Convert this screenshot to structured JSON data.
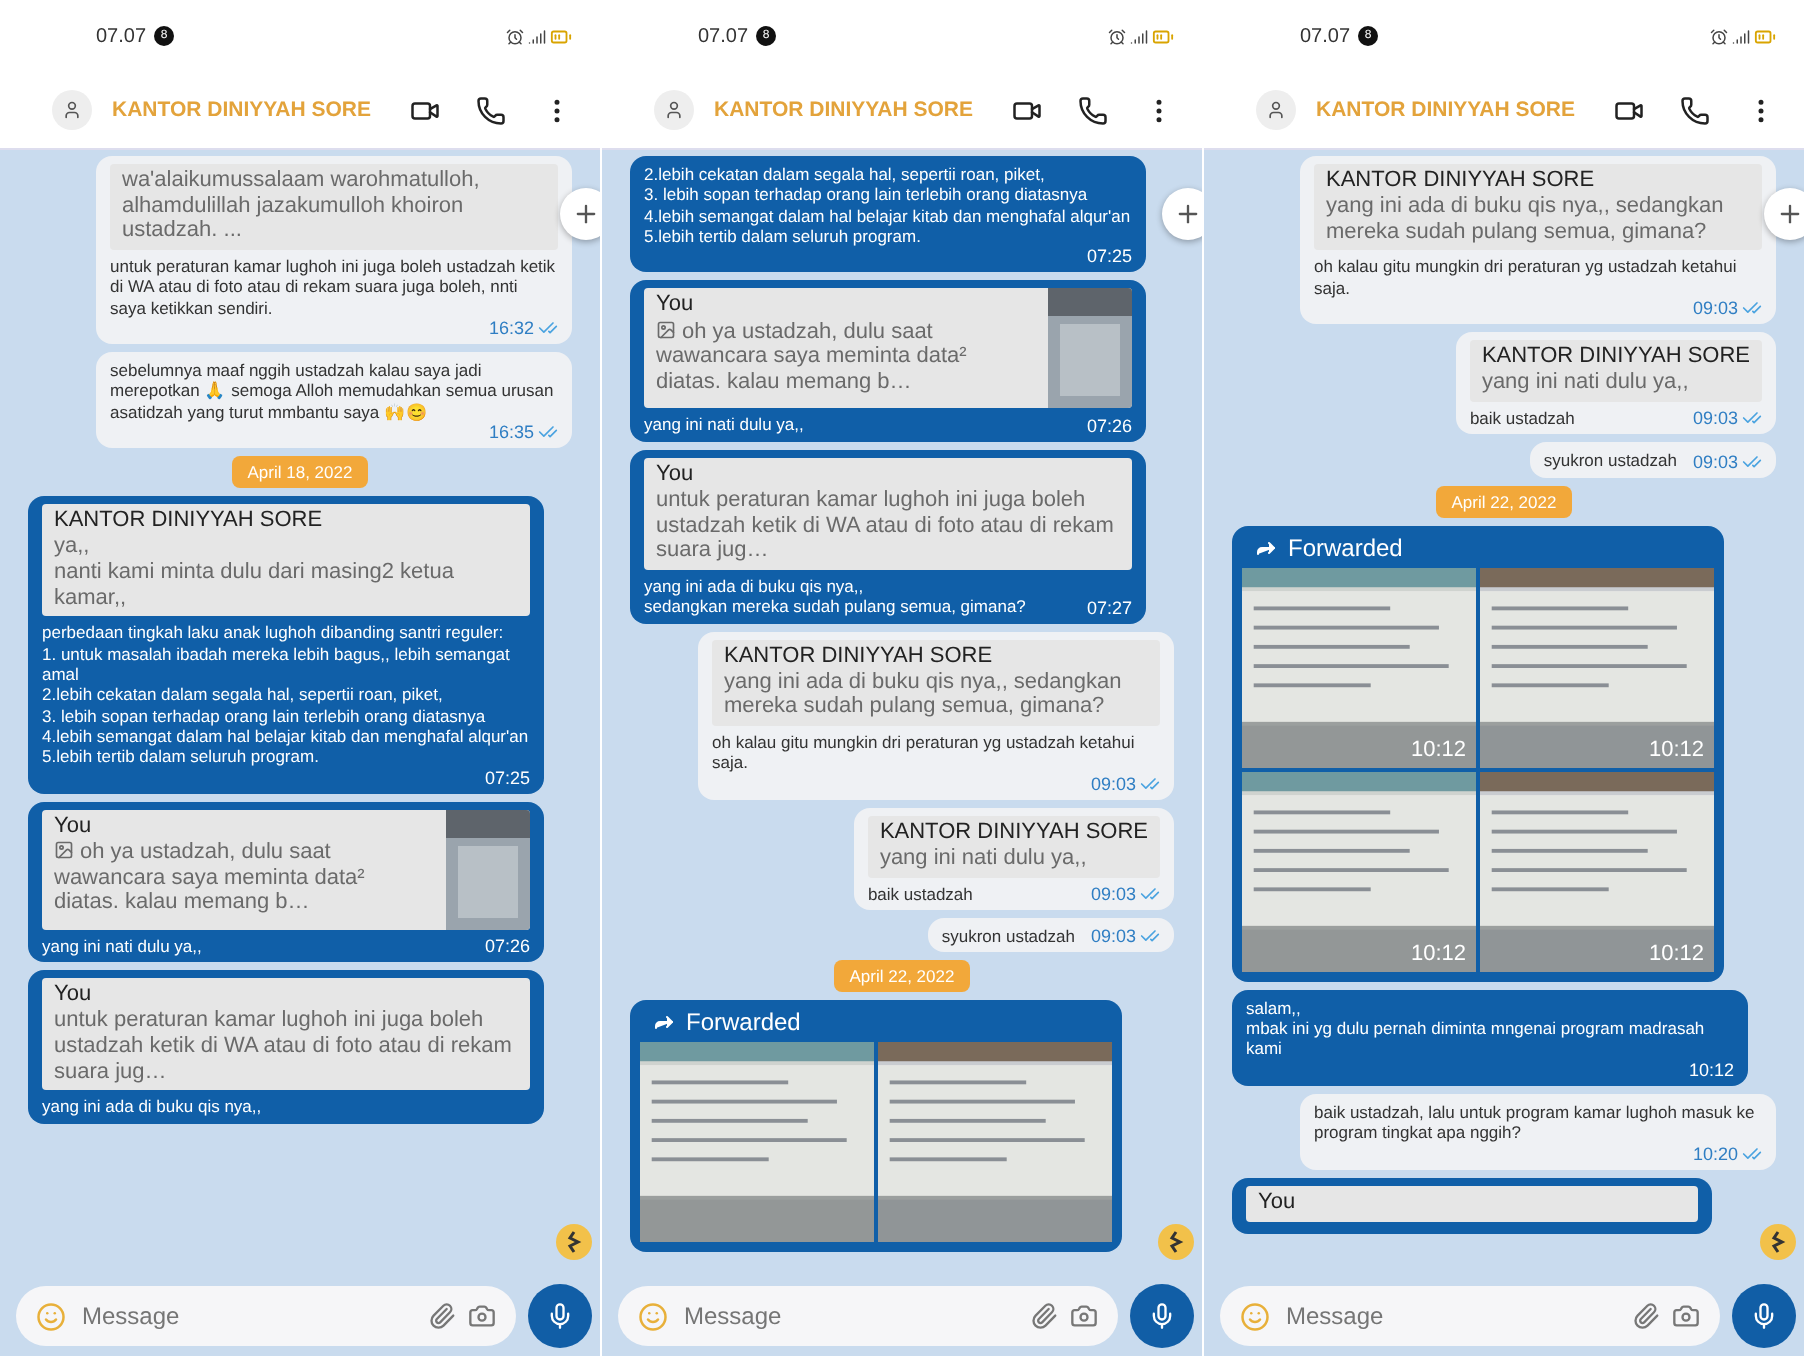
{
  "phones": [
    {
      "status": {
        "time": "07.07",
        "notification_count": "8"
      },
      "chat_title": "KANTOR DINIYYAH SORE",
      "composer": {
        "placeholder": "Message"
      },
      "messages": [
        {
          "kind": "message",
          "outgoing": true,
          "quote": {
            "text": "wa'alaikumussalaam warohmatulloh, alhamdulillah jazakumulloh khoiron ustadzah. ..."
          },
          "text": "untuk peraturan kamar lughoh ini juga boleh ustadzah ketik di WA atau di foto atau di rekam suara juga boleh, nnti saya ketikkan sendiri.",
          "time": "16:32",
          "read": true
        },
        {
          "kind": "message",
          "outgoing": true,
          "text": "sebelumnya maaf nggih ustadzah kalau saya  jadi merepotkan 🙏 semoga Alloh memudahkan semua urusan  asatidzah yang turut mmbantu saya 🙌😊",
          "time": "16:35",
          "read": true
        },
        {
          "kind": "date",
          "text": "April 18, 2022"
        },
        {
          "kind": "message",
          "outgoing": false,
          "quote": {
            "author": "KANTOR DINIYYAH SORE",
            "text": "ya,,\nnanti kami minta dulu dari masing2 ketua kamar,,"
          },
          "text": "perbedaan tingkah laku anak lughoh dibanding santri reguler:\n1. untuk masalah ibadah mereka lebih bagus,, lebih semangat amal\n2.lebih cekatan dalam segala hal, sepertii roan, piket,\n3. lebih sopan terhadap orang lain terlebih orang diatasnya\n4.lebih semangat dalam hal belajar kitab dan menghafal alqur'an\n5.lebih tertib dalam seluruh program.",
          "time": "07:25"
        },
        {
          "kind": "message",
          "outgoing": false,
          "quote": {
            "author": "You",
            "text": "oh ya ustadzah, dulu saat wawancara saya meminta data² diatas. kalau memang b…",
            "image": true
          },
          "text": "yang ini nati dulu ya,,",
          "time": "07:26"
        },
        {
          "kind": "message",
          "outgoing": false,
          "quote": {
            "author": "You",
            "text": "untuk peraturan kamar lughoh ini juga boleh ustadzah ketik di WA atau di foto atau di rekam suara jug…"
          },
          "text": "yang ini ada di buku qis nya,,"
        }
      ]
    },
    {
      "status": {
        "time": "07.07",
        "notification_count": "8"
      },
      "chat_title": "KANTOR DINIYYAH SORE",
      "composer": {
        "placeholder": "Message"
      },
      "messages": [
        {
          "kind": "message",
          "outgoing": false,
          "text": "2.lebih cekatan dalam segala hal, sepertii roan, piket,\n3. lebih sopan terhadap orang lain terlebih orang diatasnya\n4.lebih semangat dalam hal belajar kitab dan menghafal alqur'an\n5.lebih tertib dalam seluruh program.",
          "time": "07:25"
        },
        {
          "kind": "message",
          "outgoing": false,
          "quote": {
            "author": "You",
            "text": "oh ya ustadzah, dulu saat wawancara saya meminta data² diatas. kalau memang b…",
            "image": true
          },
          "text": "yang ini nati dulu ya,,",
          "time": "07:26"
        },
        {
          "kind": "message",
          "outgoing": false,
          "quote": {
            "author": "You",
            "text": "untuk peraturan kamar lughoh ini juga boleh ustadzah ketik di WA atau di foto atau di rekam suara jug…"
          },
          "text": "yang ini ada di buku qis nya,,\nsedangkan mereka sudah pulang semua, gimana?",
          "time": "07:27"
        },
        {
          "kind": "message",
          "outgoing": true,
          "quote": {
            "author": "KANTOR DINIYYAH SORE",
            "text": "yang ini ada di buku qis nya,, sedangkan mereka sudah pulang semua, gimana?"
          },
          "text": "oh kalau gitu mungkin dri peraturan yg ustadzah ketahui saja.",
          "time": "09:03",
          "read": true
        },
        {
          "kind": "message",
          "outgoing": true,
          "quote": {
            "author": "KANTOR DINIYYAH SORE",
            "text": "yang ini nati dulu ya,,"
          },
          "text": "baik ustadzah",
          "time": "09:03",
          "read": true
        },
        {
          "kind": "message",
          "outgoing": true,
          "text": "syukron ustadzah",
          "time": "09:03",
          "read": true
        },
        {
          "kind": "date",
          "text": "April 22, 2022"
        },
        {
          "kind": "forwarded",
          "label": "Forwarded"
        }
      ]
    },
    {
      "status": {
        "time": "07.07",
        "notification_count": "8"
      },
      "chat_title": "KANTOR DINIYYAH SORE",
      "composer": {
        "placeholder": "Message"
      },
      "messages": [
        {
          "kind": "message",
          "outgoing": true,
          "quote": {
            "author": "KANTOR DINIYYAH SORE",
            "text": "yang ini ada di buku qis nya,, sedangkan mereka sudah pulang semua, gimana?"
          },
          "text": "oh kalau gitu mungkin dri peraturan yg ustadzah ketahui saja.",
          "time": "09:03",
          "read": true
        },
        {
          "kind": "message",
          "outgoing": true,
          "quote": {
            "author": "KANTOR DINIYYAH SORE",
            "text": "yang ini nati dulu ya,,"
          },
          "text": "baik ustadzah",
          "time": "09:03",
          "read": true
        },
        {
          "kind": "message",
          "outgoing": true,
          "text": "syukron ustadzah",
          "time": "09:03",
          "read": true
        },
        {
          "kind": "date",
          "text": "April 22, 2022"
        },
        {
          "kind": "forwarded",
          "label": "Forwarded",
          "images": [
            {
              "kind": "picture",
              "time": "10:12"
            },
            {
              "kind": "picture",
              "time": "10:12"
            },
            {
              "kind": "picture",
              "time": "10:12"
            },
            {
              "kind": "picture",
              "time": "10:12"
            }
          ]
        },
        {
          "kind": "message",
          "outgoing": false,
          "text": "salam,,\nmbak ini yg dulu pernah diminta mngenai program madrasah kami",
          "time": "10:12"
        },
        {
          "kind": "message",
          "outgoing": true,
          "text": "baik ustadzah, lalu untuk program kamar lughoh masuk ke program tingkat apa nggih?",
          "time": "10:20",
          "read": true
        },
        {
          "kind": "message",
          "outgoing": false,
          "quote": {
            "author": "You"
          }
        }
      ]
    }
  ]
}
